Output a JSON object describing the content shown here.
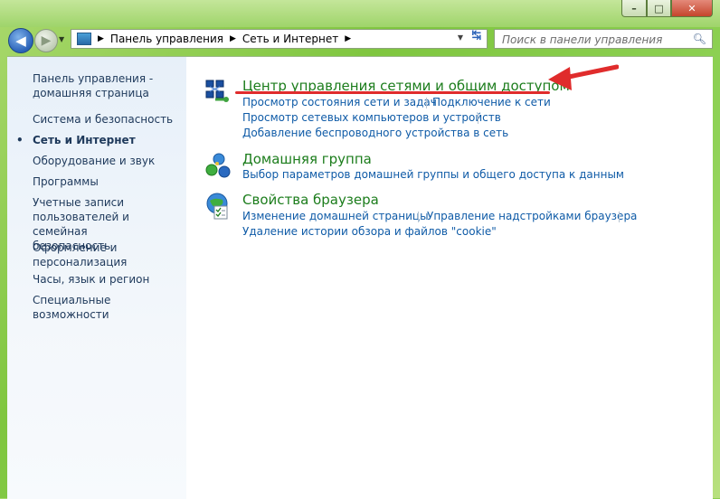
{
  "window": {
    "buttons": {
      "minimize": "–",
      "maximize": "□",
      "close": "✕"
    }
  },
  "nav": {
    "breadcrumb": [
      "Панель управления",
      "Сеть и Интернет"
    ],
    "search_placeholder": "Поиск в панели управления"
  },
  "sidebar": {
    "items": [
      {
        "label": "Панель управления -\nдомашняя страница"
      },
      {
        "label": "Система и безопасность"
      },
      {
        "label": "Сеть и Интернет",
        "active": true
      },
      {
        "label": "Оборудование и звук"
      },
      {
        "label": "Программы"
      },
      {
        "label": "Учетные записи\nпользователей и семейная\nбезопасность"
      },
      {
        "label": "Оформление и\nперсонализация"
      },
      {
        "label": "Часы, язык и регион"
      },
      {
        "label": "Специальные возможности"
      }
    ]
  },
  "categories": [
    {
      "title": "Центр управления сетями и общим доступом",
      "icon": "network-center-icon",
      "links": [
        "Просмотр состояния сети и задач",
        "Подключение к сети",
        "Просмотр сетевых компьютеров и устройств",
        "Добавление беспроводного устройства в сеть"
      ]
    },
    {
      "title": "Домашняя группа",
      "icon": "homegroup-icon",
      "links": [
        "Выбор параметров домашней группы и общего доступа к данным"
      ]
    },
    {
      "title": "Свойства браузера",
      "icon": "browser-properties-icon",
      "links": [
        "Изменение домашней страницы",
        "Управление надстройками браузера",
        "Удаление истории обзора и файлов \"cookie\""
      ]
    }
  ],
  "colors": {
    "annotation": "#e02c2c",
    "link": "#0f5ba7",
    "category_title": "#1c7d1c"
  }
}
